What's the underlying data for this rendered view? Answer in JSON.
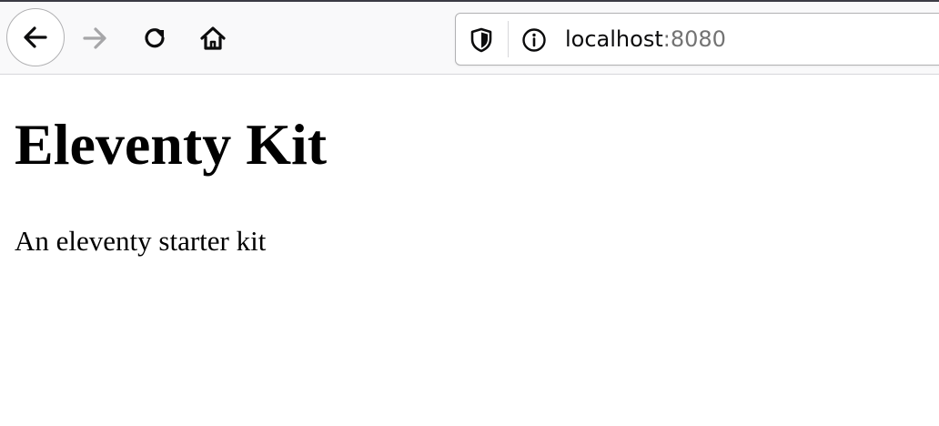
{
  "browser": {
    "url": {
      "host": "localhost",
      "port": ":8080"
    },
    "icons": {
      "back": "back-arrow-icon",
      "forward": "forward-arrow-icon",
      "reload": "reload-icon",
      "home": "home-icon",
      "tracking_protection": "shield-icon",
      "site_info": "info-icon"
    },
    "forward_enabled": false
  },
  "page": {
    "title": "Eleventy Kit",
    "subtitle": "An eleventy starter kit"
  }
}
